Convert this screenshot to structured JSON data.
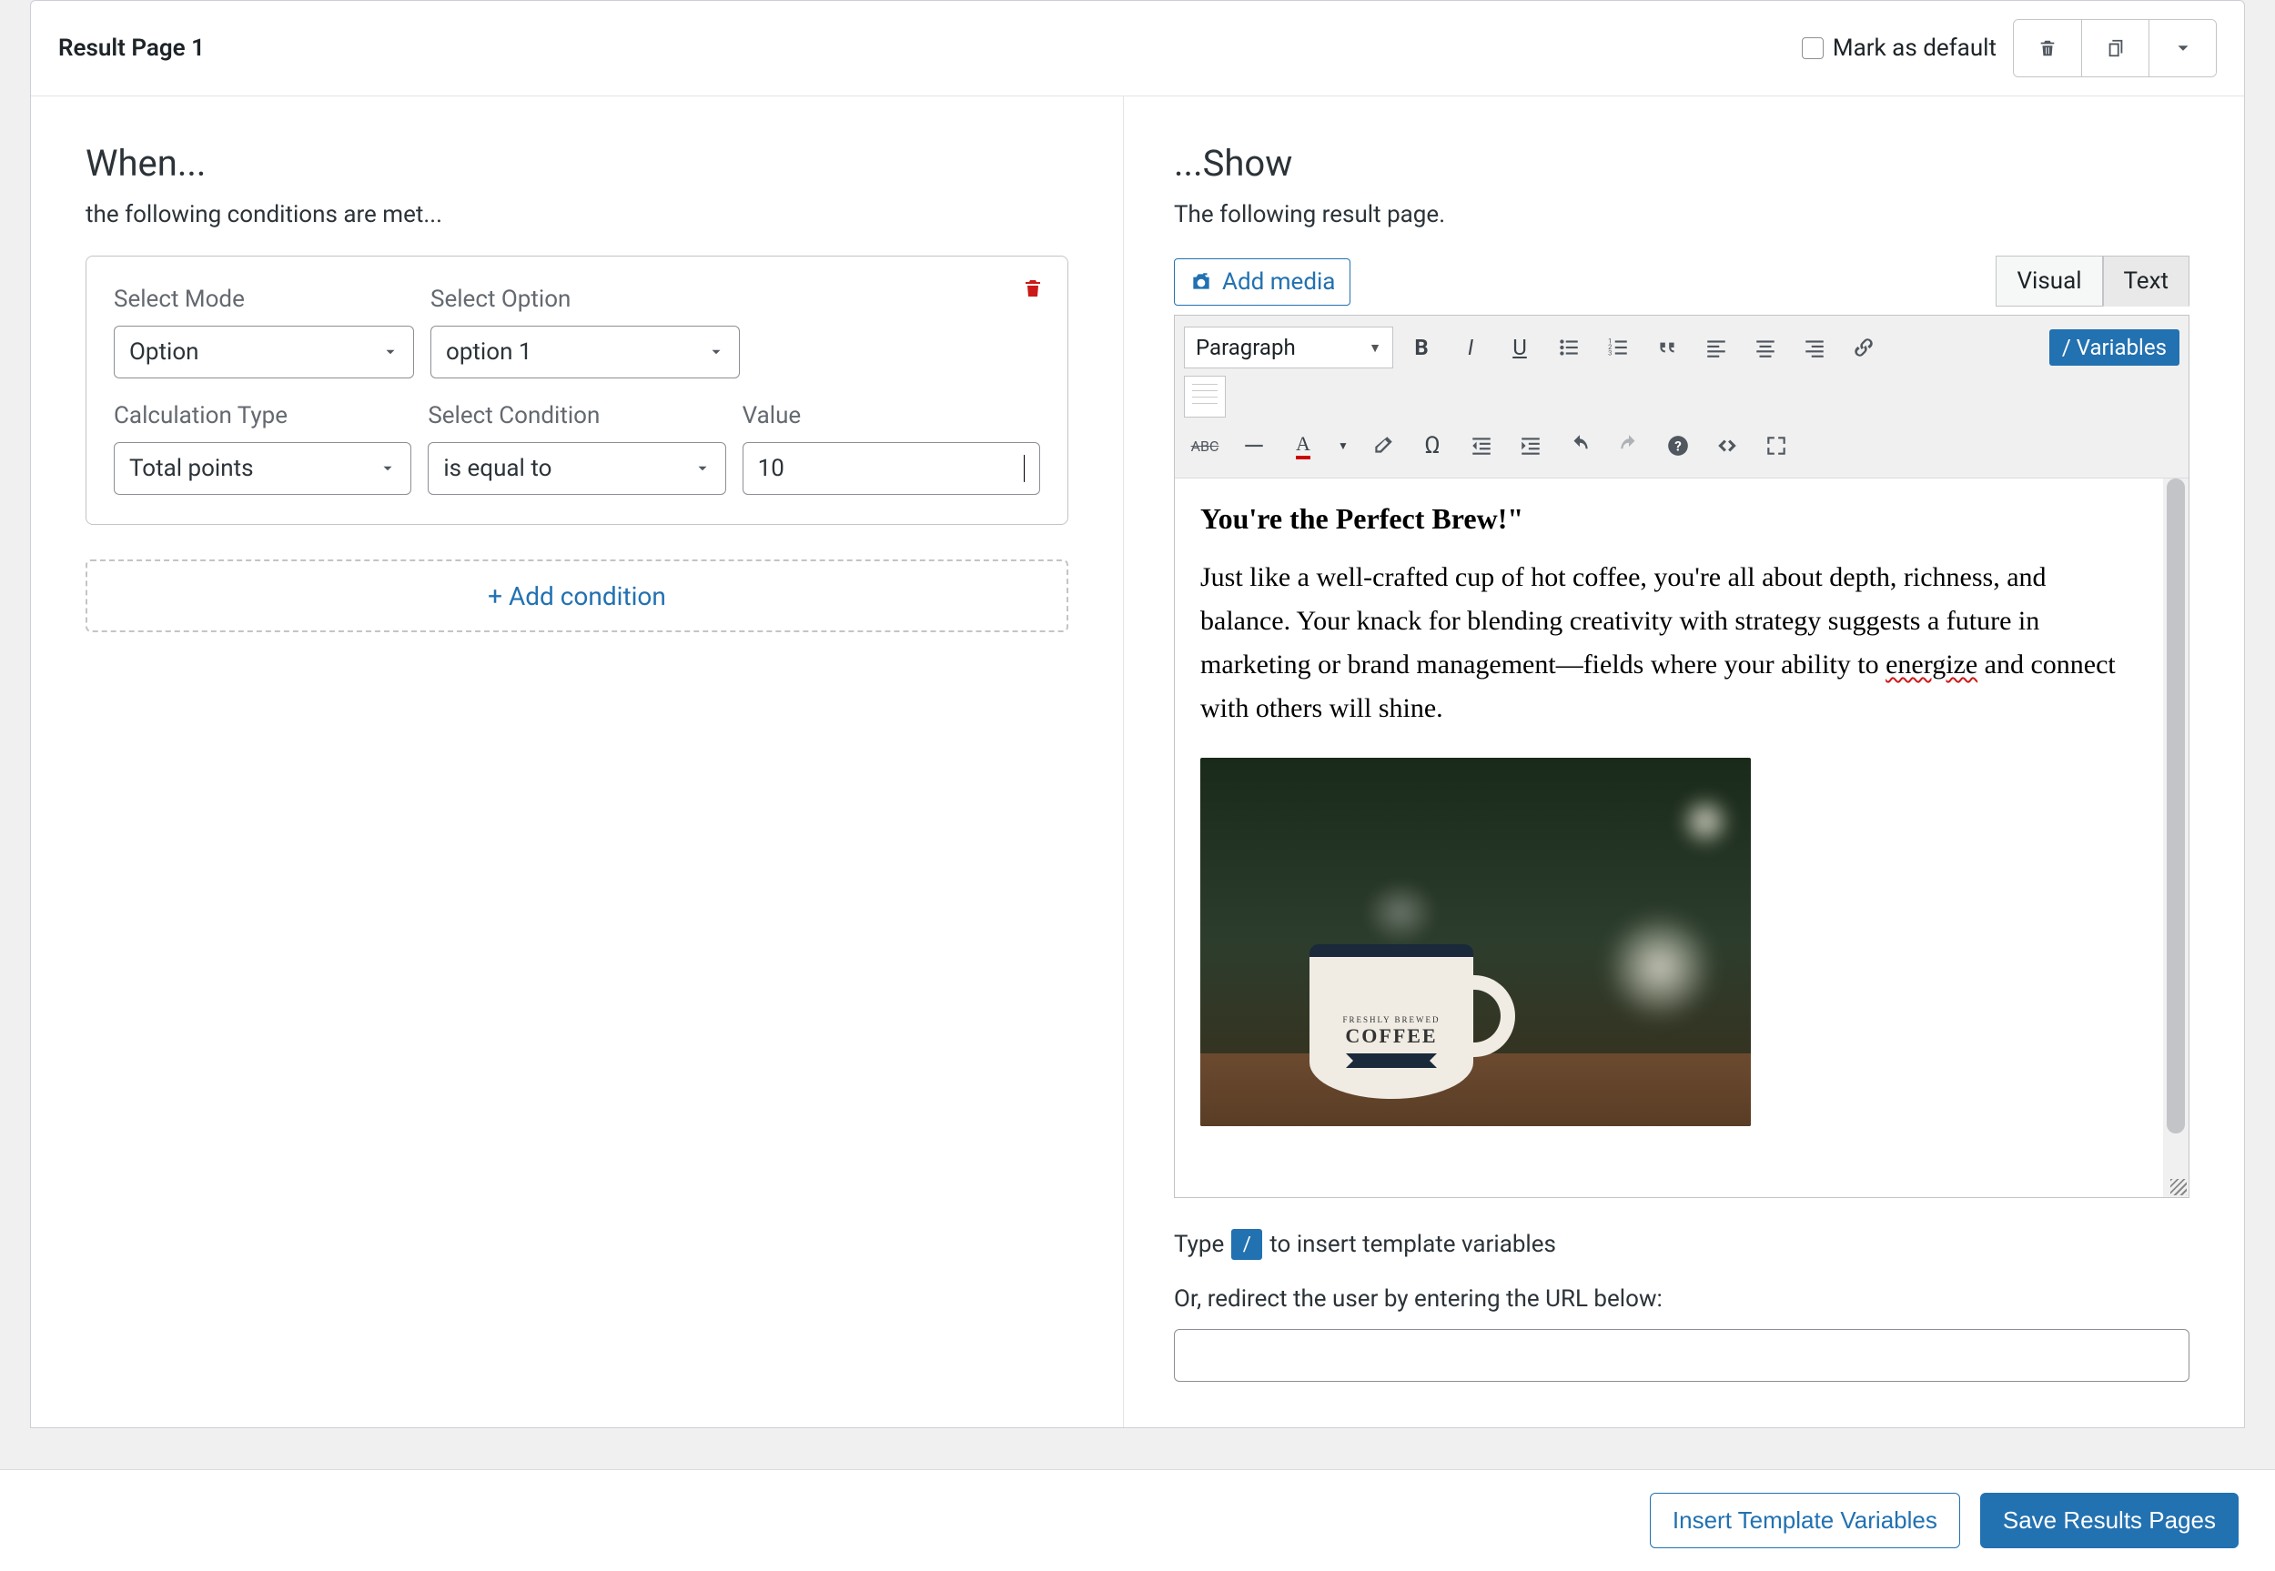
{
  "header": {
    "title": "Result Page 1",
    "mark_default_label": "Mark as default"
  },
  "when": {
    "title": "When...",
    "sub": "the following conditions are met...",
    "labels": {
      "select_mode": "Select Mode",
      "select_option": "Select Option",
      "calc_type": "Calculation Type",
      "select_condition": "Select Condition",
      "value": "Value"
    },
    "values": {
      "mode": "Option",
      "option": "option 1",
      "calc_type": "Total points",
      "condition": "is equal to",
      "value": "10"
    },
    "add_condition": "+ Add condition"
  },
  "show": {
    "title": "...Show",
    "sub": "The following result page.",
    "add_media": "Add media",
    "tabs": {
      "visual": "Visual",
      "text": "Text"
    },
    "format_select": "Paragraph",
    "variables_btn": "/ Variables",
    "content": {
      "heading": "You're the Perfect Brew!\"",
      "para_pre": "Just like a well-crafted cup of hot coffee, you're all about depth, richness, and balance. Your knack for blending creativity with strategy suggests a future in marketing or brand management—fields where your ability to ",
      "para_squiggle": "energize",
      "para_post": " and connect with others will shine."
    },
    "mug": {
      "brand_top": "FRESHLY BREWED",
      "brand": "COFFEE"
    },
    "hint_pre": "Type",
    "hint_key": "/",
    "hint_post": "to insert template variables",
    "redirect_label": "Or, redirect the user by entering the URL below:",
    "redirect_value": ""
  },
  "footer": {
    "insert_vars": "Insert Template Variables",
    "save": "Save Results Pages"
  },
  "icons": {
    "trash": "trash-icon",
    "copy": "copy-icon",
    "chevron_down": "chevron-down-icon",
    "camera": "camera-icon"
  }
}
